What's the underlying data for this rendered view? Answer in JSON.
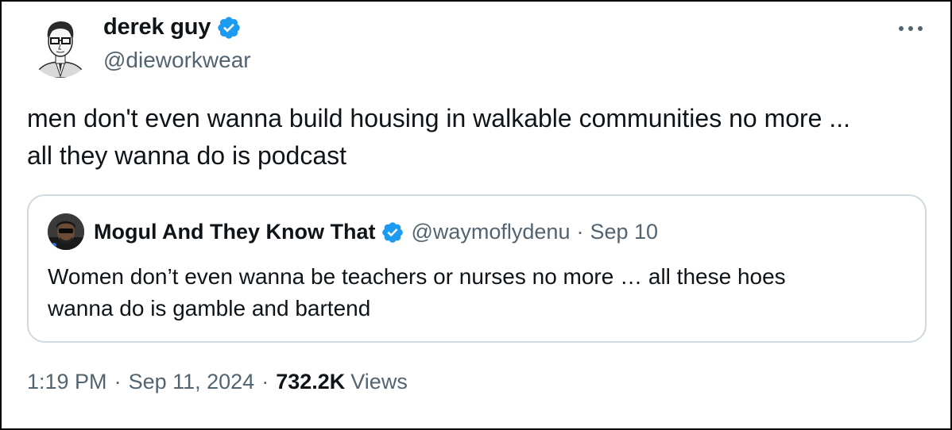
{
  "author": {
    "display_name": "derek guy",
    "handle": "@dieworkwear",
    "verified": true
  },
  "tweet": {
    "text_line_1": "men don't even wanna build housing in walkable communities no more ...",
    "text_line_2": "all they wanna do is podcast"
  },
  "quoted_tweet": {
    "display_name": "Mogul And They Know That",
    "handle": "@waymoflydenu",
    "separator": "·",
    "date": "Sep 10",
    "text_line_1": "Women don’t even wanna be teachers or nurses no more … all these hoes",
    "text_line_2": "wanna do is gamble and bartend"
  },
  "meta": {
    "time": "1:19 PM",
    "separator": "·",
    "date": "Sep 11, 2024",
    "views_count": "732.2K",
    "views_label": "Views"
  },
  "icons": {
    "more": "more-horizontal-icon",
    "verified": "verified-badge-icon"
  },
  "colors": {
    "text_primary": "#0f1419",
    "text_secondary": "#536471",
    "verified_blue": "#1d9bf0",
    "quote_border": "#cfd9de"
  }
}
